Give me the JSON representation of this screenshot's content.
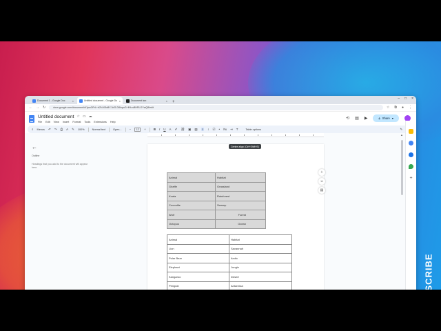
{
  "overlay": {
    "subscribe": "SUBSCRIBE"
  },
  "browser": {
    "tabs": [
      {
        "title": "Document 1 - Google Doc",
        "active": false
      },
      {
        "title": "Untitled document - Google Do",
        "active": true
      },
      {
        "title": "Document two",
        "active": false
      }
    ],
    "new_tab": "+",
    "url": "docs.google.com/document/d/1pwOFrL+b2N-K5d8Y-3dG-D8lnpoG+lKb-sBHRLOYwQ8/edit"
  },
  "doc": {
    "title": "Untitled document",
    "menu": [
      "File",
      "Edit",
      "View",
      "Insert",
      "Format",
      "Tools",
      "Extensions",
      "Help"
    ],
    "share_label": "Share"
  },
  "toolbar": {
    "menus": "Menus",
    "zoom": "100%",
    "style": "Normal text",
    "font": "Open...",
    "font_size": "12",
    "table_options": "Table options"
  },
  "tooltip": "Centre align (Ctrl+Shift+E)",
  "outline": {
    "title": "Outline",
    "hint": "Headings that you add to the document will appear here."
  },
  "table1": [
    [
      "Animal",
      "Habitat"
    ],
    [
      "Giraffe",
      "Grassland"
    ],
    [
      "Koala",
      "Rainforest"
    ],
    [
      "Crocodile",
      "Swamp"
    ],
    [
      "Wolf",
      "Forest"
    ],
    [
      "Octopus",
      "Ocean"
    ]
  ],
  "table2": [
    [
      "Animal",
      "Habitat"
    ],
    [
      "Lion",
      "Savannah"
    ],
    [
      "Polar Bear",
      "Arctic"
    ],
    [
      "Elephant",
      "Jungle"
    ],
    [
      "Kangaroo",
      "Desert"
    ],
    [
      "Penguin",
      "Antarctica"
    ]
  ],
  "colors": {
    "accent": "#4285f4",
    "share_bg": "#c2e7ff",
    "toolbar_bg": "#edf2fa",
    "table_shade": "#d9d9d9"
  }
}
